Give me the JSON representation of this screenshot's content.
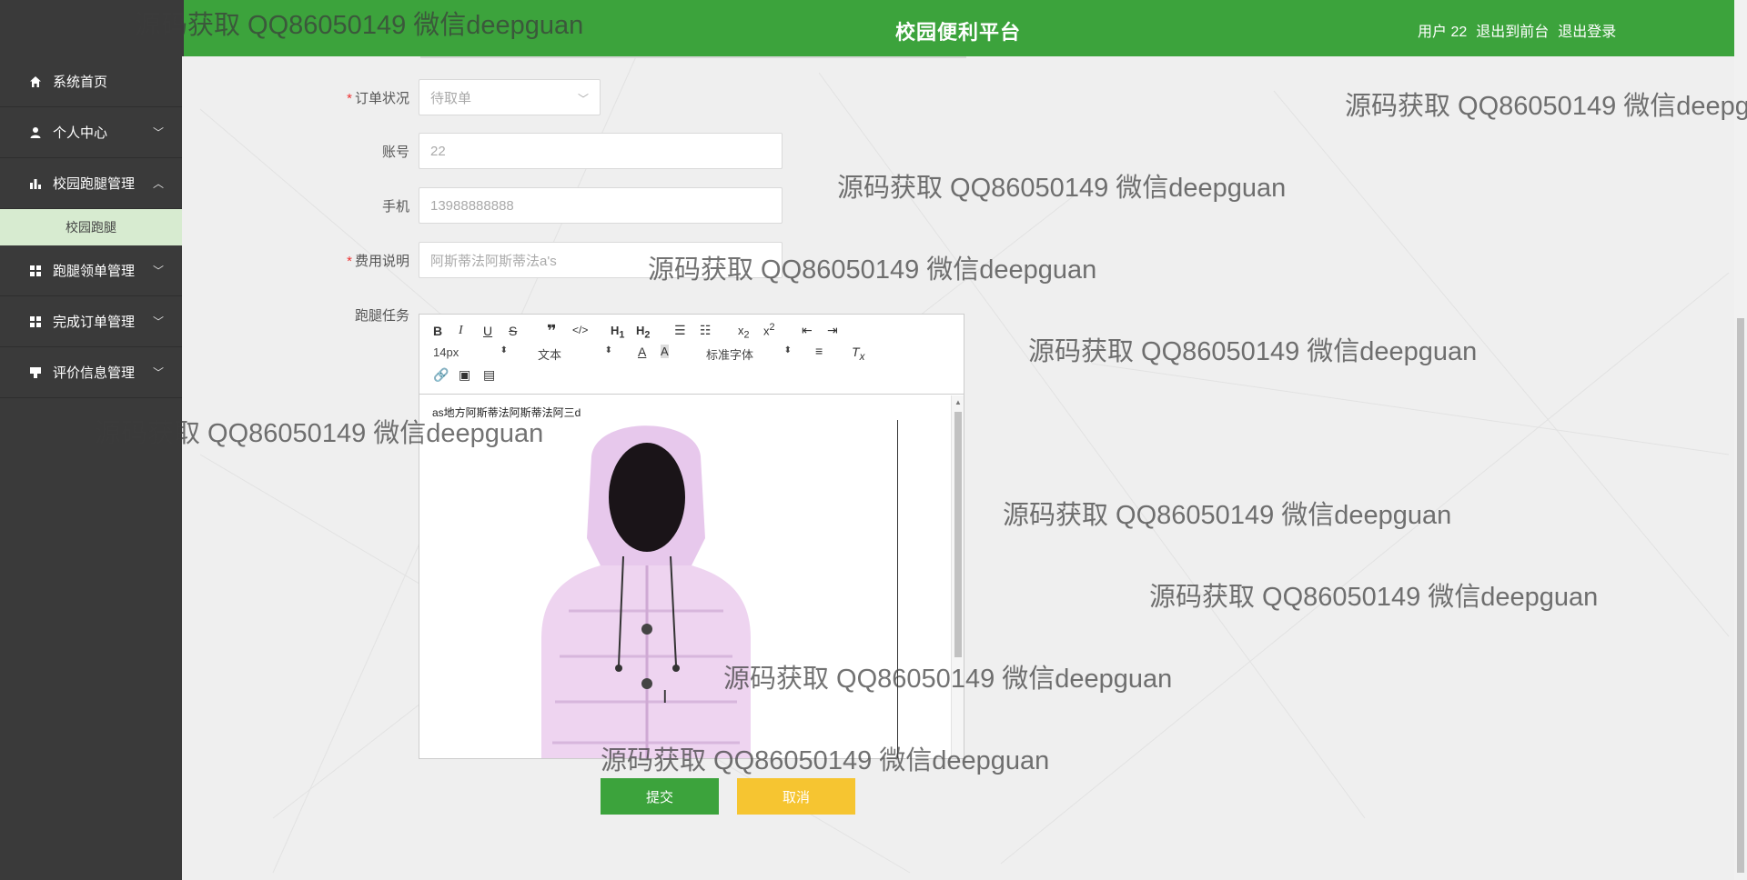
{
  "header": {
    "title": "校园便利平台",
    "user_label": "用户 22",
    "back_label": "退出到前台",
    "logout_label": "退出登录"
  },
  "sidebar": {
    "items": [
      {
        "label": "系统首页",
        "icon": "home-icon"
      },
      {
        "label": "个人中心",
        "icon": "user-icon"
      },
      {
        "label": "校园跑腿管理",
        "icon": "bar-chart-icon"
      },
      {
        "label": "跑腿领单管理",
        "icon": "grid-icon"
      },
      {
        "label": "完成订单管理",
        "icon": "grid-icon"
      },
      {
        "label": "评价信息管理",
        "icon": "comment-icon"
      }
    ],
    "submenu_label": "校园跑腿"
  },
  "form": {
    "status": {
      "label": "订单状况",
      "value": "待取单"
    },
    "account": {
      "label": "账号",
      "value": "22"
    },
    "phone": {
      "label": "手机",
      "value": "13988888888"
    },
    "fee": {
      "label": "费用说明",
      "value": "阿斯蒂法阿斯蒂法a's"
    },
    "task": {
      "label": "跑腿任务"
    }
  },
  "editor": {
    "font_size": "14px",
    "paragraph": "文本",
    "font_family": "标准字体",
    "content_text": "as地方阿斯蒂法阿斯蒂法阿三d"
  },
  "buttons": {
    "submit": "提交",
    "cancel": "取消"
  },
  "watermark": "源码获取 QQ86050149 微信deepguan",
  "colors": {
    "header_green": "#3ca33c",
    "sidebar_dark": "#3a3a3a",
    "submenu_bg": "#d7ebd0",
    "cancel_yellow": "#f6c531"
  }
}
